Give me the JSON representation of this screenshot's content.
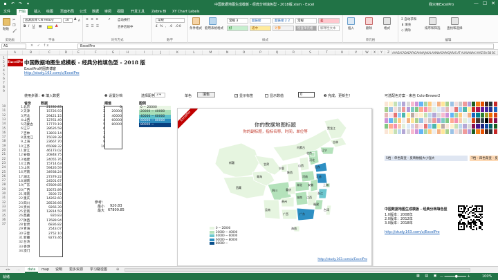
{
  "window": {
    "title": "中国数据地图生成模板 - 经典分档填色型 - 2018版.xlsm  -  Excel",
    "user": "我只用ExcelPro",
    "controls": [
      "—",
      "☐",
      "✕"
    ]
  },
  "qat": {
    "items": [
      "save-icon",
      "undo-icon",
      "redo-icon",
      "customize-icon"
    ]
  },
  "ribbon_tabs": [
    "文件",
    "开始",
    "插入",
    "绘图",
    "页面布局",
    "公式",
    "数据",
    "审阅",
    "视图",
    "开发工具",
    "Zebra BI",
    "XY Chart Labels"
  ],
  "ribbon_active": "开始",
  "ribbon": {
    "clipboard": {
      "label": "剪贴板",
      "paste": "粘贴"
    },
    "font": {
      "label": "字体",
      "font_name": "思源黑体 CN Heavy",
      "font_size": "10",
      "bold": "B",
      "italic": "I",
      "underline": "U",
      "grow": "A",
      "shrink": "A"
    },
    "alignment": {
      "label": "对齐方式",
      "wrap": "自动换行",
      "merge": "合并后居中"
    },
    "number": {
      "label": "数字",
      "format": "常规"
    },
    "styles": {
      "label": "样式",
      "cond_format": "条件格式",
      "table_format": "套用表格格式",
      "cells": [
        {
          "text": "常规 3",
          "bg": "#ffffff",
          "fg": "#111111"
        },
        {
          "text": "超链接",
          "bg": "#ffffff",
          "fg": "#1a5fb4"
        },
        {
          "text": "超链接 2 2",
          "bg": "#ffffff",
          "fg": "#1a5fb4"
        },
        {
          "text": "常规",
          "bg": "#ffffff",
          "fg": "#111111"
        },
        {
          "text": "差",
          "bg": "#ffc7ce",
          "fg": "#9c0006"
        },
        {
          "text": "好",
          "bg": "#c6efce",
          "fg": "#006100"
        },
        {
          "text": "适中",
          "bg": "#ffeb9c",
          "fg": "#9c5700"
        },
        {
          "text": "计算",
          "bg": "#f2f2f2",
          "fg": "#fa7d00"
        },
        {
          "text": "检查单元格",
          "bg": "#a5a5a5",
          "fg": "#ffffff"
        },
        {
          "text": "解释性文本",
          "bg": "#ffffff",
          "fg": "#7f7f7f"
        }
      ]
    },
    "cells_group": {
      "label": "单元格",
      "insert": "插入",
      "delete": "删除",
      "format": "格式"
    },
    "editing": {
      "label": "编辑",
      "autosum": "自动求和",
      "fill": "填充",
      "clear": "清除",
      "sort": "排序和筛选",
      "find": "查找和选择"
    }
  },
  "formula_bar": {
    "name": "A1",
    "value": "ExcelPro"
  },
  "columns": [
    "A",
    "B",
    "C",
    "D",
    "E",
    "F",
    "G",
    "H",
    "I",
    "J",
    "K",
    "L",
    "M",
    "N",
    "O",
    "P",
    "Q",
    "R",
    "S",
    "T",
    "U",
    "V",
    "W",
    "X",
    "Y",
    "Z",
    "AAAEACADAEAFAGAHAIAJAKALAMANAOAPAQARAS AT AUAVAWAX AYAZ BA BB BC"
  ],
  "rows_visible": [
    "1",
    "2",
    "3",
    "4",
    "5",
    "6",
    "7",
    "8",
    "9",
    "10",
    "11",
    "12",
    "13",
    "14",
    "15",
    "16",
    "17",
    "18",
    "19",
    "20",
    "21",
    "22",
    "23",
    "24",
    "25",
    "26",
    "27",
    "28",
    "29",
    "30",
    "31",
    "32",
    "33",
    "34",
    "35",
    "36",
    "37"
  ],
  "header": {
    "logo": "ExcelPro",
    "title": "中国数据地图生成模板 - 经典分档填色型 - 2018 版",
    "subtitle": "ExcelPro的图表博客",
    "link": "http://study.163.com/u/ExcelPro"
  },
  "controls": {
    "step1": "使用步骤：❶ 填入数据",
    "step2": "❷ 设置分档",
    "palette_label": "选择配色",
    "palette_value": "3",
    "single_color": "单色",
    "btn_label": "填色",
    "show_title": "显示标签",
    "show_value": "显示数值",
    "value_box": "0",
    "step_done": "❸ 完成，更新生！"
  },
  "table": {
    "h_province": "省份",
    "h_data": "数据",
    "h_thresholds": "阈值",
    "provinces": [
      "北京",
      "天津",
      "河北",
      "山西",
      "内蒙古",
      "辽宁",
      "吉林",
      "黑龙江",
      "上海",
      "江苏",
      "浙江",
      "安徽",
      "福建",
      "江西",
      "山东",
      "河南",
      "湖北",
      "湖南",
      "广东",
      "广西",
      "海南",
      "重庆",
      "四川",
      "贵州",
      "云南",
      "西藏",
      "陕西",
      "甘肃",
      "青海",
      "宁夏",
      "新疆",
      "台湾",
      "香港",
      "澳门"
    ],
    "values": [
      "21330.83",
      "15726.93",
      "29421.15",
      "12761.49",
      "17770.19",
      "28626.58",
      "13803.14",
      "15039.38",
      "23667.70",
      "65088.32",
      "46173.02",
      "20848.75",
      "24055.76",
      "15714.63",
      "59426.59",
      "34938.24",
      "27379.22",
      "24501.67",
      "67809.85",
      "15672.89",
      "3500.72",
      "14262.60",
      "28536.66",
      "9266.39",
      "12814.59",
      "920.83",
      "17689.94",
      "6836.82",
      "2543.07",
      "2752.10",
      "9273.46",
      "",
      "",
      " "
    ],
    "row_nums": [
      "1",
      "2",
      "3",
      "4",
      "5",
      "6",
      "7",
      "8",
      "9",
      "10",
      "11",
      "12",
      "13",
      "14",
      "15",
      "16",
      "17",
      "18",
      "19",
      "20",
      "21",
      "22",
      "23",
      "24",
      "25",
      "26",
      "27",
      "28",
      "29",
      "30",
      "31",
      "32",
      "33",
      "34"
    ],
    "thresholds": [
      "0",
      "20000",
      "40000",
      "60000",
      "80000",
      "",
      "",
      "",
      "",
      ""
    ],
    "threshold_idx": [
      "1",
      "2",
      "3",
      "4",
      "5",
      "6",
      "7",
      "8",
      "9",
      "10"
    ]
  },
  "legend_mini": {
    "title": "图例",
    "items": [
      {
        "text": "0 ~ 20000",
        "color": "#e9f6e4"
      },
      {
        "text": "20000 ~ 40000",
        "color": "#a9dfb9"
      },
      {
        "text": "40000 ~ 60000",
        "color": "#5cc1cc"
      },
      {
        "text": "60000 ~ 80000",
        "color": "#2b8cbe"
      },
      {
        "text": "80000 ~",
        "color": "#084081"
      }
    ]
  },
  "stats": {
    "ref": "参考：",
    "max_label": "最小",
    "max_value": "920.83",
    "min_label": "最大",
    "min_value": "67809.85"
  },
  "map": {
    "corner": "ExcelPro",
    "title": "你的数据地图标题",
    "subtitle": "你的副标题，指标名称，时间，单位等",
    "legend": [
      {
        "text": "0 ~ 20000",
        "color": "#e6f5e0"
      },
      {
        "text": "20000 ~ 40000",
        "color": "#b4e2bb"
      },
      {
        "text": "40000 ~ 60000",
        "color": "#6cc7cf"
      },
      {
        "text": "60000 ~ 80000",
        "color": "#2e8fc3"
      },
      {
        "text": "80000 ~",
        "color": "#0b4f8a"
      }
    ],
    "labels": [
      "新疆",
      "西藏",
      "青海",
      "甘肃",
      "内蒙古",
      "黑龙江",
      "吉林",
      "辽宁",
      "北京",
      "河北",
      "山西",
      "山东",
      "河南",
      "江苏",
      "上海",
      "浙江",
      "安徽",
      "湖北",
      "四川",
      "重庆",
      "陕西",
      "宁夏",
      "贵州",
      "云南",
      "广西",
      "广东",
      "湖南",
      "江西",
      "福建",
      "台湾",
      "海南"
    ],
    "credit": "http://study.163.com/u/ExcelPro"
  },
  "palette": {
    "title": "可选配色方案 - 来自 ColorBrewer2",
    "note_left": "5档 - 单色渐变 - 反映数据大小强大",
    "note_right": "7档 - 四色渐变 - 反"
  },
  "info": {
    "title": "中国数据地图生成模板 - 经典分档填色型",
    "lines": [
      "1.0版本：2008年",
      "2.0版本：2012年",
      "3.0版本：2018年"
    ],
    "link": "http://study.163.com/u/ExcelPro"
  },
  "sheet_tabs": [
    "data",
    "map",
    "说明",
    "更多资源",
    "学习路径图"
  ],
  "sheet_active": "data",
  "status": {
    "left": "就绪",
    "zoom": "100%"
  }
}
